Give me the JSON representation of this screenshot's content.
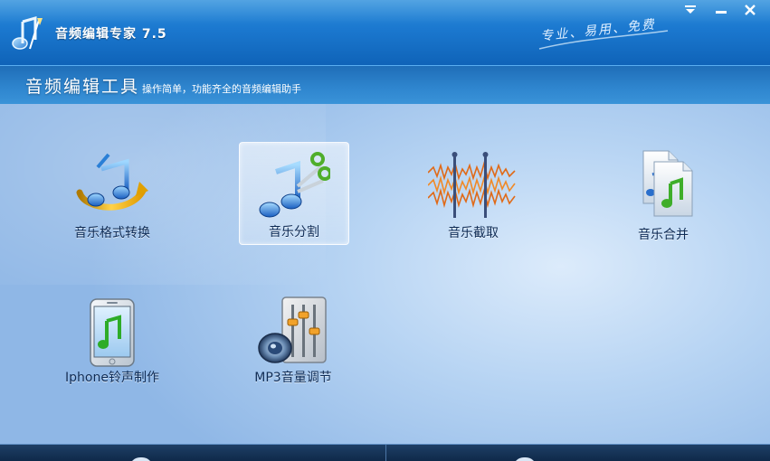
{
  "window": {
    "title": "音频编辑专家 7.5",
    "slogan": "专业、易用、免费",
    "controls": {
      "menu": "menu",
      "minimize": "minimize",
      "close": "close"
    }
  },
  "header": {
    "title": "音频编辑工具",
    "subtitle": "操作简单，功能齐全的音频编辑助手"
  },
  "tools": [
    {
      "label": "音乐格式转换",
      "icon": "music-convert-icon"
    },
    {
      "label": "音乐分割",
      "icon": "music-split-icon",
      "selected": true
    },
    {
      "label": "音乐截取",
      "icon": "waveform-cut-icon"
    },
    {
      "label": "音乐合并",
      "icon": "music-merge-icon"
    },
    {
      "label": "Iphone铃声制作",
      "icon": "iphone-ringtone-icon"
    },
    {
      "label": "MP3音量调节",
      "icon": "volume-adjust-icon"
    }
  ],
  "colors": {
    "titlebar": "#1b78cf",
    "header": "#2f86cf",
    "main_bg": "#b7d4f3",
    "label_text": "#0e2b55"
  }
}
